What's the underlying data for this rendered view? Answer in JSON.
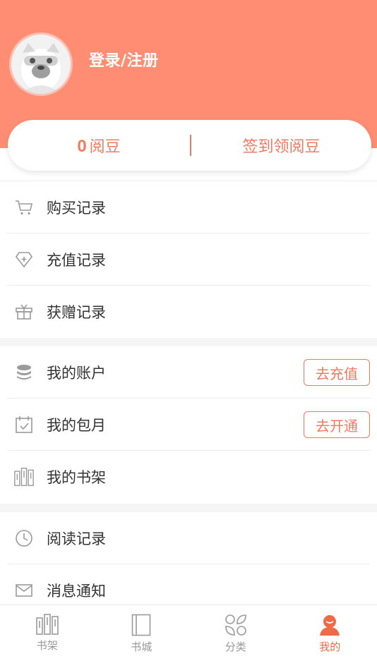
{
  "header": {
    "login_text": "登录/注册"
  },
  "beans": {
    "count": "0",
    "unit": "阅豆",
    "signin_label": "签到领阅豆"
  },
  "section1": [
    {
      "label": "购买记录",
      "icon": "cart-icon"
    },
    {
      "label": "充值记录",
      "icon": "diamond-icon"
    },
    {
      "label": "获赠记录",
      "icon": "gift-icon"
    }
  ],
  "section2": [
    {
      "label": "我的账户",
      "icon": "coins-icon",
      "action": "去充值"
    },
    {
      "label": "我的包月",
      "icon": "calendar-check-icon",
      "action": "去开通"
    },
    {
      "label": "我的书架",
      "icon": "bookshelf-icon"
    }
  ],
  "section3": [
    {
      "label": "阅读记录",
      "icon": "clock-icon"
    },
    {
      "label": "消息通知",
      "icon": "mail-icon"
    }
  ],
  "tabbar": [
    {
      "label": "书架",
      "icon": "bookshelf-icon",
      "active": false
    },
    {
      "label": "书城",
      "icon": "book-icon",
      "active": false
    },
    {
      "label": "分类",
      "icon": "category-icon",
      "active": false
    },
    {
      "label": "我的",
      "icon": "user-icon",
      "active": true
    }
  ],
  "colors": {
    "accent": "#ff8d73",
    "accent_text": "#f07a5f",
    "active_tab": "#ef6a46"
  }
}
